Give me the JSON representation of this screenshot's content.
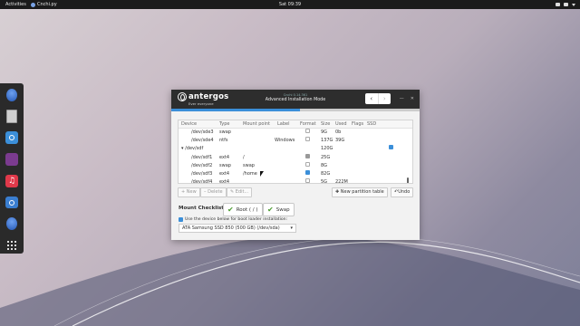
{
  "topbar": {
    "activities": "Activities",
    "app_name": "Cnchi.py",
    "clock": "Sat 09:39"
  },
  "window": {
    "brand": "antergos",
    "tagline": "Ever  everyone",
    "subtitle": "Cnchi 0.14.361",
    "title": "Advanced Installation Mode",
    "nav_prev": "‹",
    "nav_next": "›",
    "install_progress_fraction": 0.52
  },
  "table": {
    "headers": [
      "Device",
      "Type",
      "Mount point",
      "Label",
      "Format",
      "Size",
      "Used",
      "Flags",
      "SSD"
    ],
    "rows": [
      {
        "device": "/dev/sde3",
        "type": "swap",
        "mount": "",
        "label": "",
        "format": "none",
        "size": "9G",
        "used": "0b",
        "ssd": false
      },
      {
        "device": "/dev/sde4",
        "type": "ntfs",
        "mount": "",
        "label": "Windows",
        "format": "none",
        "size": "137G",
        "used": "39G",
        "ssd": false
      },
      {
        "device": "▾ /dev/sdf",
        "type": "",
        "mount": "",
        "label": "",
        "format": "",
        "size": "120G",
        "used": "",
        "ssd": true
      },
      {
        "device": "/dev/sdf1",
        "type": "ext4",
        "mount": "/",
        "label": "",
        "format": "grey",
        "size": "25G",
        "used": "",
        "ssd": false
      },
      {
        "device": "/dev/sdf2",
        "type": "swap",
        "mount": "swap",
        "label": "",
        "format": "none",
        "size": "8G",
        "used": "",
        "ssd": false
      },
      {
        "device": "/dev/sdf3",
        "type": "ext4",
        "mount": "/home",
        "label": "",
        "format": "checked",
        "size": "82G",
        "used": "",
        "ssd": false
      },
      {
        "device": "/dev/sdf4",
        "type": "ext4",
        "mount": "",
        "label": "",
        "format": "none",
        "size": "5G",
        "used": "222M",
        "ssd": false
      }
    ]
  },
  "toolbar": {
    "new": "+ New",
    "delete": "– Delete",
    "edit": "✎ Edit...",
    "new_table": "New partition table",
    "undo": "Undo"
  },
  "mount_checklist": {
    "label": "Mount Checklist:",
    "root": "Root ( / )",
    "swap": "Swap"
  },
  "bootloader": {
    "checkbox_label": "Use the device below for boot loader installation:",
    "device": "ATA Samsung SSD 850 (500 GB) (/dev/sda)"
  }
}
